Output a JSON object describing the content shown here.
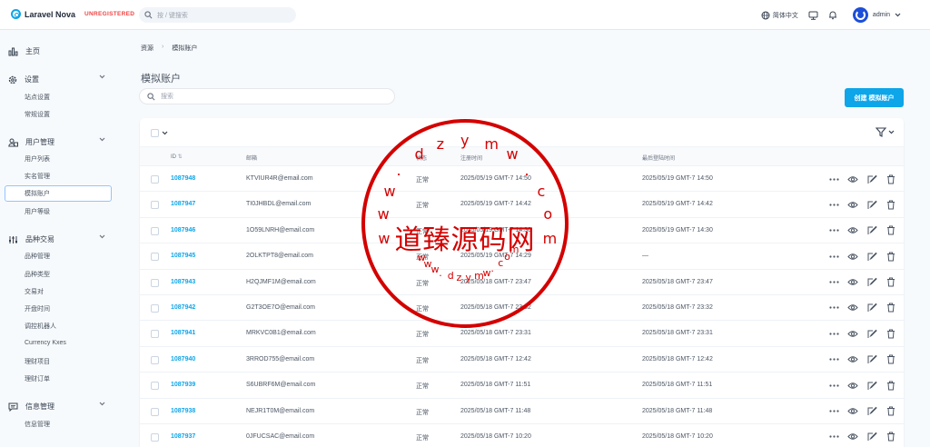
{
  "header": {
    "brand": "Laravel Nova",
    "badge": "UNREGISTERED",
    "search_placeholder": "按 / 键搜索",
    "language": "简体中文",
    "user": "admin"
  },
  "sidebar": {
    "home": "主页",
    "settings": {
      "label": "设置",
      "items": [
        "站点设置",
        "常规设置"
      ]
    },
    "users": {
      "label": "用户管理",
      "items": [
        "用户列表",
        "实名管理",
        "模拟账户",
        "用户等级"
      ]
    },
    "trading": {
      "label": "品种交易",
      "items": [
        "品种管理",
        "品种类型",
        "交易对",
        "开盘时间",
        "调控机器人",
        "Currency Kxes",
        "理财项目",
        "理财订单"
      ]
    },
    "messages": {
      "label": "信息管理",
      "items": [
        "信息管理"
      ]
    }
  },
  "breadcrumb": {
    "root": "资源",
    "current": "模拟账户"
  },
  "page": {
    "title": "模拟账户",
    "search_placeholder": "搜索",
    "create_button": "创建 模拟账户"
  },
  "table": {
    "columns": {
      "id": "ID",
      "email": "邮箱",
      "status": "状态",
      "registered": "注册时间",
      "last_login": "最后登陆时间"
    },
    "rows": [
      {
        "id": "1087948",
        "email": "KTVIUR4R@email.com",
        "status": "正常",
        "registered": "2025/05/19 GMT-7 14:50",
        "last_login": "2025/05/19 GMT-7 14:50"
      },
      {
        "id": "1087947",
        "email": "TI0JHBDL@email.com",
        "status": "正常",
        "registered": "2025/05/19 GMT-7 14:42",
        "last_login": "2025/05/19 GMT-7 14:42"
      },
      {
        "id": "1087946",
        "email": "1O59LNRH@email.com",
        "status": "正常",
        "registered": "2025/05/19 GMT-7 14:30",
        "last_login": "2025/05/19 GMT-7 14:30"
      },
      {
        "id": "1087945",
        "email": "2OLKTPT8@email.com",
        "status": "正常",
        "registered": "2025/05/19 GMT-7 14:29",
        "last_login": "—"
      },
      {
        "id": "1087943",
        "email": "H2QJMF1M@email.com",
        "status": "正常",
        "registered": "2025/05/18 GMT-7 23:47",
        "last_login": "2025/05/18 GMT-7 23:47"
      },
      {
        "id": "1087942",
        "email": "G2T3OE7O@email.com",
        "status": "正常",
        "registered": "2025/05/18 GMT-7 23:32",
        "last_login": "2025/05/18 GMT-7 23:32"
      },
      {
        "id": "1087941",
        "email": "MRKVC0B1@email.com",
        "status": "正常",
        "registered": "2025/05/18 GMT-7 23:31",
        "last_login": "2025/05/18 GMT-7 23:31"
      },
      {
        "id": "1087940",
        "email": "3RROD755@email.com",
        "status": "正常",
        "registered": "2025/05/18 GMT-7 12:42",
        "last_login": "2025/05/18 GMT-7 12:42"
      },
      {
        "id": "1087939",
        "email": "S6UBRF6M@email.com",
        "status": "正常",
        "registered": "2025/05/18 GMT-7 11:51",
        "last_login": "2025/05/18 GMT-7 11:51"
      },
      {
        "id": "1087938",
        "email": "NEJR1T0M@email.com",
        "status": "正常",
        "registered": "2025/05/18 GMT-7 11:48",
        "last_login": "2025/05/18 GMT-7 11:48"
      },
      {
        "id": "1087937",
        "email": "0JFUCSAC@email.com",
        "status": "正常",
        "registered": "2025/05/18 GMT-7 10:20",
        "last_login": "2025/05/18 GMT-7 10:20"
      }
    ]
  },
  "watermark": {
    "text": "道臻源码网",
    "ring_upper": "www.dzymw.com",
    "ring_lower": "www.dzymw.com",
    "color": "#d40000"
  },
  "colors": {
    "accent": "#0ea5e9",
    "danger": "#ef4444"
  }
}
